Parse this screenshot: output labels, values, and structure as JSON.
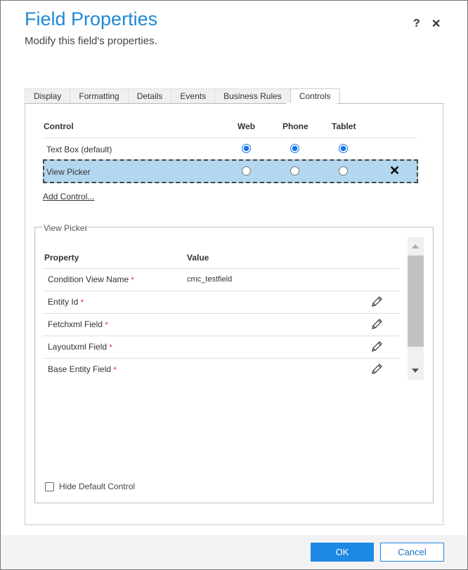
{
  "header": {
    "title": "Field Properties",
    "subtitle": "Modify this field's properties.",
    "help": "?",
    "close": "✕"
  },
  "tabs": [
    {
      "label": "Display"
    },
    {
      "label": "Formatting"
    },
    {
      "label": "Details"
    },
    {
      "label": "Events"
    },
    {
      "label": "Business Rules"
    },
    {
      "label": "Controls",
      "active": true
    }
  ],
  "controls": {
    "headers": {
      "control": "Control",
      "web": "Web",
      "phone": "Phone",
      "tablet": "Tablet"
    },
    "rows": [
      {
        "name": "Text Box (default)",
        "web": true,
        "phone": true,
        "tablet": true
      },
      {
        "name": "View Picker",
        "web": false,
        "phone": false,
        "tablet": false,
        "selected": true,
        "remove": "✕"
      }
    ],
    "add_control": "Add Control..."
  },
  "properties": {
    "legend": "View Picker",
    "headers": {
      "property": "Property",
      "value": "Value"
    },
    "rows": [
      {
        "name": "Condition View Name",
        "required": "*",
        "value": "cmc_testfield",
        "editable": false
      },
      {
        "name": "Entity Id",
        "required": "*",
        "value": "",
        "editable": true
      },
      {
        "name": "Fetchxml Field",
        "required": "*",
        "value": "",
        "editable": true
      },
      {
        "name": "Layoutxml Field",
        "required": "*",
        "value": "",
        "editable": true
      },
      {
        "name": "Base Entity Field",
        "required": "*",
        "value": "",
        "editable": true
      }
    ],
    "hide_default_control": {
      "label": "Hide Default Control",
      "checked": false
    }
  },
  "footer": {
    "ok": "OK",
    "cancel": "Cancel"
  },
  "colors": {
    "accent": "#1e88e5",
    "title": "#1e88d6",
    "selected_row": "#b3d7ee"
  }
}
